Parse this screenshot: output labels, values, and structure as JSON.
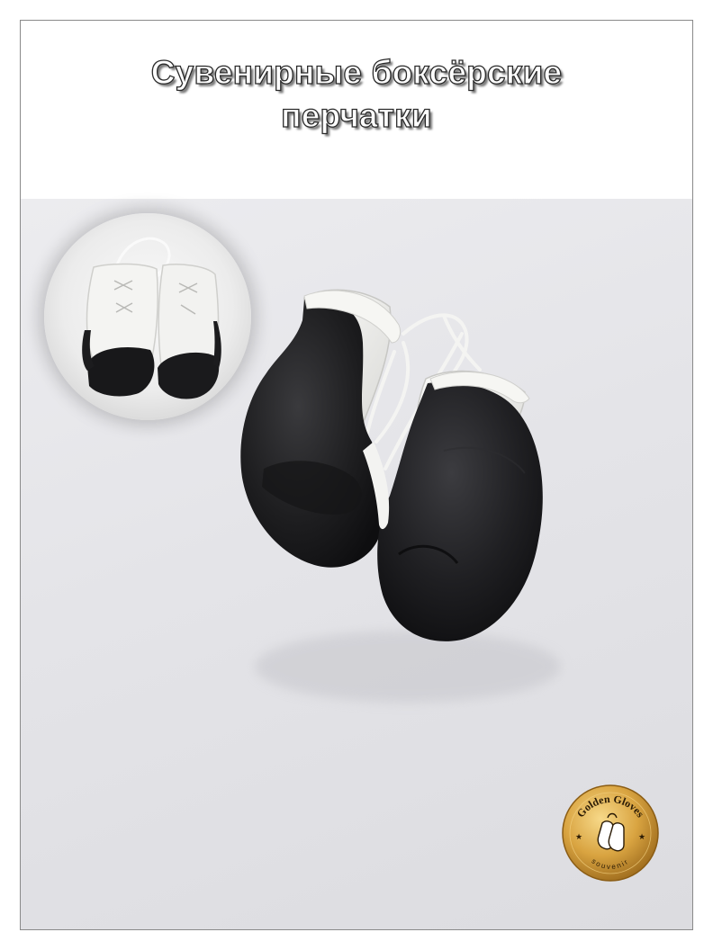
{
  "header": {
    "title_line1": "Сувенирные боксёрские",
    "title_line2": "перчатки"
  },
  "badge": {
    "brand": "Golden Gloves",
    "tagline": "souvenir"
  },
  "colors": {
    "gold": "#d9a441",
    "glove_black": "#1c1c1e",
    "glove_white": "#f2f2f0",
    "background": "#e6e6ea"
  },
  "icons": [
    "boxing-gloves-icon",
    "star-icon"
  ]
}
